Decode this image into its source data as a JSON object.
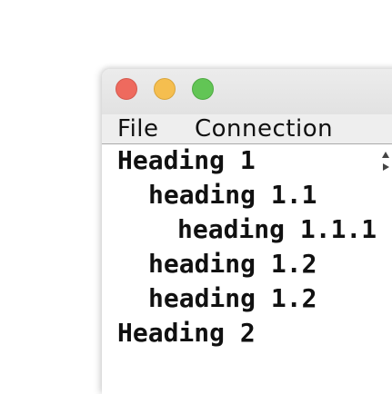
{
  "menubar": {
    "items": [
      {
        "label": "File"
      },
      {
        "label": "Connection"
      }
    ]
  },
  "outline": {
    "items": [
      {
        "label": "Heading 1",
        "level": 1
      },
      {
        "label": "heading 1.1",
        "level": 2
      },
      {
        "label": "heading 1.1.1",
        "level": 3
      },
      {
        "label": "heading 1.2",
        "level": 2
      },
      {
        "label": "heading 1.2",
        "level": 2
      },
      {
        "label": "Heading 2",
        "level": 1
      }
    ]
  },
  "colors": {
    "close": "#ee6a5e",
    "minimize": "#f5be4f",
    "maximize": "#62c555",
    "menubar_bg": "#eeeeee",
    "titlebar_bg": "#e6e6e6"
  },
  "icons": {
    "split_arrows": [
      "arrow-up-icon",
      "arrow-right-icon"
    ]
  }
}
